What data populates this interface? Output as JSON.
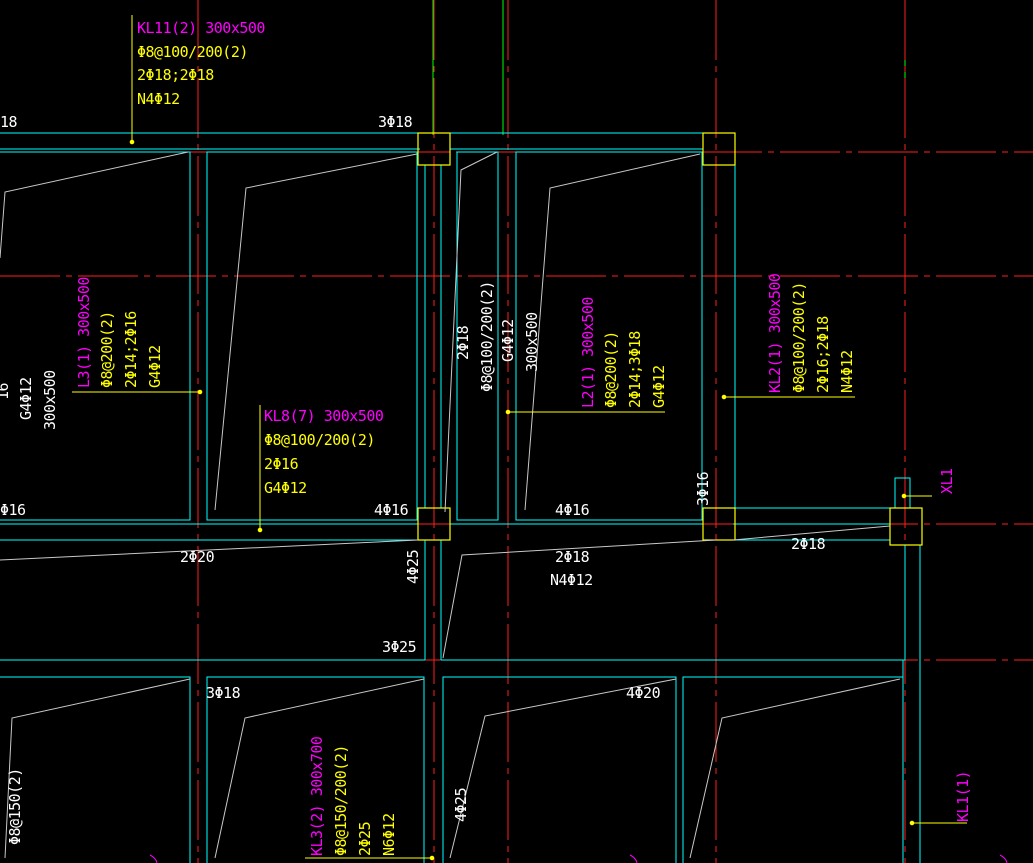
{
  "colors": {
    "background": "#000000",
    "axis_line": "#ff2020",
    "beam_outline": "#00ffff",
    "slab_line": "#c0c0c0",
    "magenta_text": "#ff00ff",
    "yellow_text": "#ffff00",
    "white_text": "#ffffff",
    "green_line": "#00ff00"
  },
  "labels": {
    "kl11_id": "KL11(2) 300x500",
    "kl11_stirrup": "Φ8@100/200(2)",
    "kl11_bars": "2Φ18;2Φ18",
    "kl11_waist": "N4Φ12",
    "left_top_18": "18",
    "top_3phi18": "3Φ18",
    "l3_id": "L3(1) 300x500",
    "l3_stirrup": "Φ8@200(2)",
    "l3_bars": "2Φ14;2Φ16",
    "l3_waist": "G4Φ12",
    "left_partial_16": "16",
    "left_g4": "G4Φ12",
    "left_300": "300x500",
    "kl8_id": "KL8(7) 300x500",
    "kl8_stirrup": "Φ8@100/200(2)",
    "kl8_bars": "2Φ16",
    "kl8_waist": "G4Φ12",
    "mid_2phi18": "2Φ18",
    "mid_stirrup": "Φ8@100/200(2)",
    "mid_g4": "G4Φ12",
    "mid_300": "300x500",
    "l2_id": "L2(1) 300x500",
    "l2_stirrup": "Φ8@200(2)",
    "l2_bars": "2Φ14;3Φ18",
    "l2_waist": "G4Φ12",
    "kl2_id": "KL2(1) 300x500",
    "kl2_stirrup": "Φ8@100/200(2)",
    "kl2_bars": "2Φ16;2Φ18",
    "kl2_waist": "N4Φ12",
    "row_phi16_left": "Φ16",
    "row_4phi16_a": "4Φ16",
    "row_4phi16_b": "4Φ16",
    "row_3phi16": "3Φ16",
    "row_2phi20": "2Φ20",
    "row_4phi25_a": "4Φ25",
    "row_2phi18_a": "2Φ18",
    "row_n4": "N4Φ12",
    "row_2phi18_b": "2Φ18",
    "row_3phi25": "3Φ25",
    "xl1": "XL1",
    "bot_3phi18": "3Φ18",
    "bot_4phi20": "4Φ20",
    "bot_left_stirrup": "Φ8@150(2)",
    "kl3_id": "KL3(2) 300x700",
    "kl3_stirrup": "Φ8@150/200(2)",
    "kl3_bars": "2Φ25",
    "kl3_waist": "N6Φ12",
    "bot_4phi25": "4Φ25",
    "kl1_id": "KL1(1)"
  }
}
